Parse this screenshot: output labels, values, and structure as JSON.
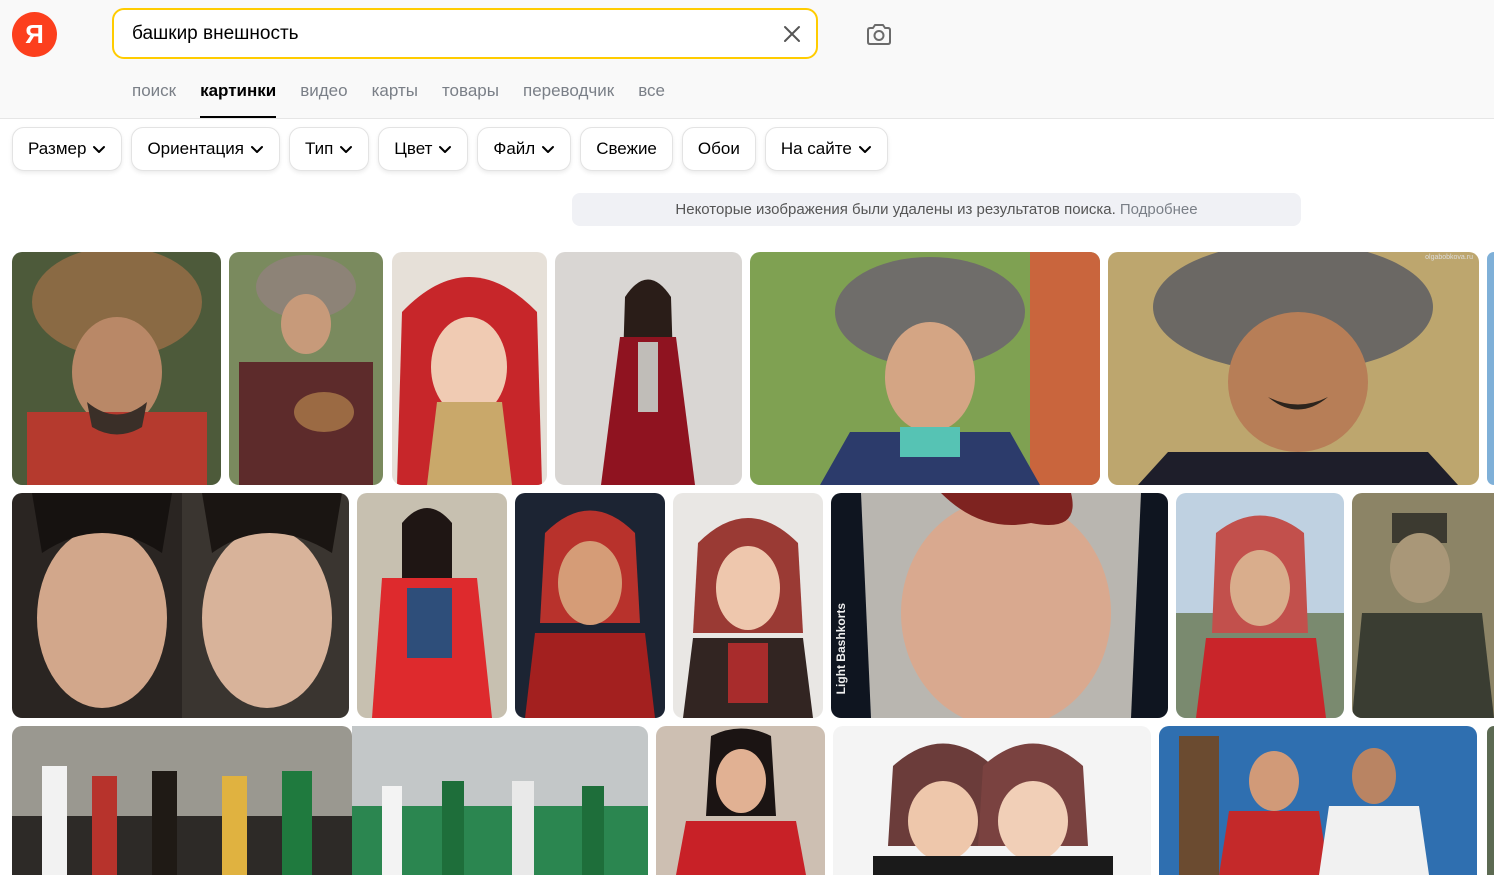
{
  "logo": {
    "letter": "Я"
  },
  "search": {
    "value": "башкир внешность"
  },
  "icons": {
    "clear": "close-icon",
    "camera": "camera-search-icon",
    "chevron": "chevron-down-icon"
  },
  "tabs": [
    {
      "label": "поиск"
    },
    {
      "label": "картинки",
      "active": true
    },
    {
      "label": "видео"
    },
    {
      "label": "карты"
    },
    {
      "label": "товары"
    },
    {
      "label": "переводчик"
    },
    {
      "label": "все"
    }
  ],
  "filters": [
    {
      "label": "Размер",
      "dropdown": true
    },
    {
      "label": "Ориентация",
      "dropdown": true
    },
    {
      "label": "Тип",
      "dropdown": true
    },
    {
      "label": "Цвет",
      "dropdown": true
    },
    {
      "label": "Файл",
      "dropdown": true
    },
    {
      "label": "Свежие",
      "dropdown": false
    },
    {
      "label": "Обои",
      "dropdown": false
    },
    {
      "label": "На сайте",
      "dropdown": true
    }
  ],
  "notice": {
    "text": "Некоторые изображения были удалены из результатов поиска.",
    "link": "Подробнее"
  },
  "watermarks": {
    "olgabobkova": "olgabobkova.ru",
    "light_bashkorts": "Light Bashkorts"
  },
  "colors": {
    "brand_red": "#fc3f1d",
    "search_border": "#ffcc00"
  }
}
